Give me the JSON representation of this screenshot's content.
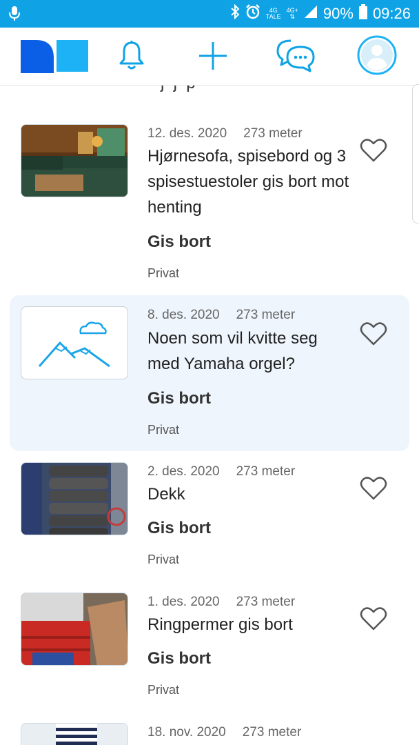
{
  "status_bar": {
    "network_top": "4G",
    "network_bottom": "TALE",
    "network2": "4G+",
    "battery": "90%",
    "time": "09:26",
    "icons": [
      "mic-icon",
      "bluetooth-icon",
      "alarm-icon",
      "signal-icon",
      "battery-icon"
    ]
  },
  "nav": {
    "icons": [
      "logo",
      "bell-icon",
      "plus-icon",
      "chat-icon",
      "avatar-icon"
    ],
    "accent": "#0fa3e6",
    "logo_dark": "#0a5fe6",
    "logo_light": "#1cb2f5"
  },
  "listings": [
    {
      "date": "12. des. 2020",
      "distance": "273 meter",
      "title": "Hjørnesofa, spisebord og 3 spisestuestoler gis bort mot henting",
      "price": "Gis bort",
      "seller": "Privat"
    },
    {
      "date": "8. des. 2020",
      "distance": "273 meter",
      "title": "Noen som vil kvitte seg med Yamaha orgel?",
      "price": "Gis bort",
      "seller": "Privat"
    },
    {
      "date": "2. des. 2020",
      "distance": "273 meter",
      "title": "Dekk",
      "price": "Gis bort",
      "seller": "Privat"
    },
    {
      "date": "1. des. 2020",
      "distance": "273 meter",
      "title": "Ringpermer gis bort",
      "price": "Gis bort",
      "seller": "Privat"
    },
    {
      "date": "18. nov. 2020",
      "distance": "273 meter"
    }
  ]
}
